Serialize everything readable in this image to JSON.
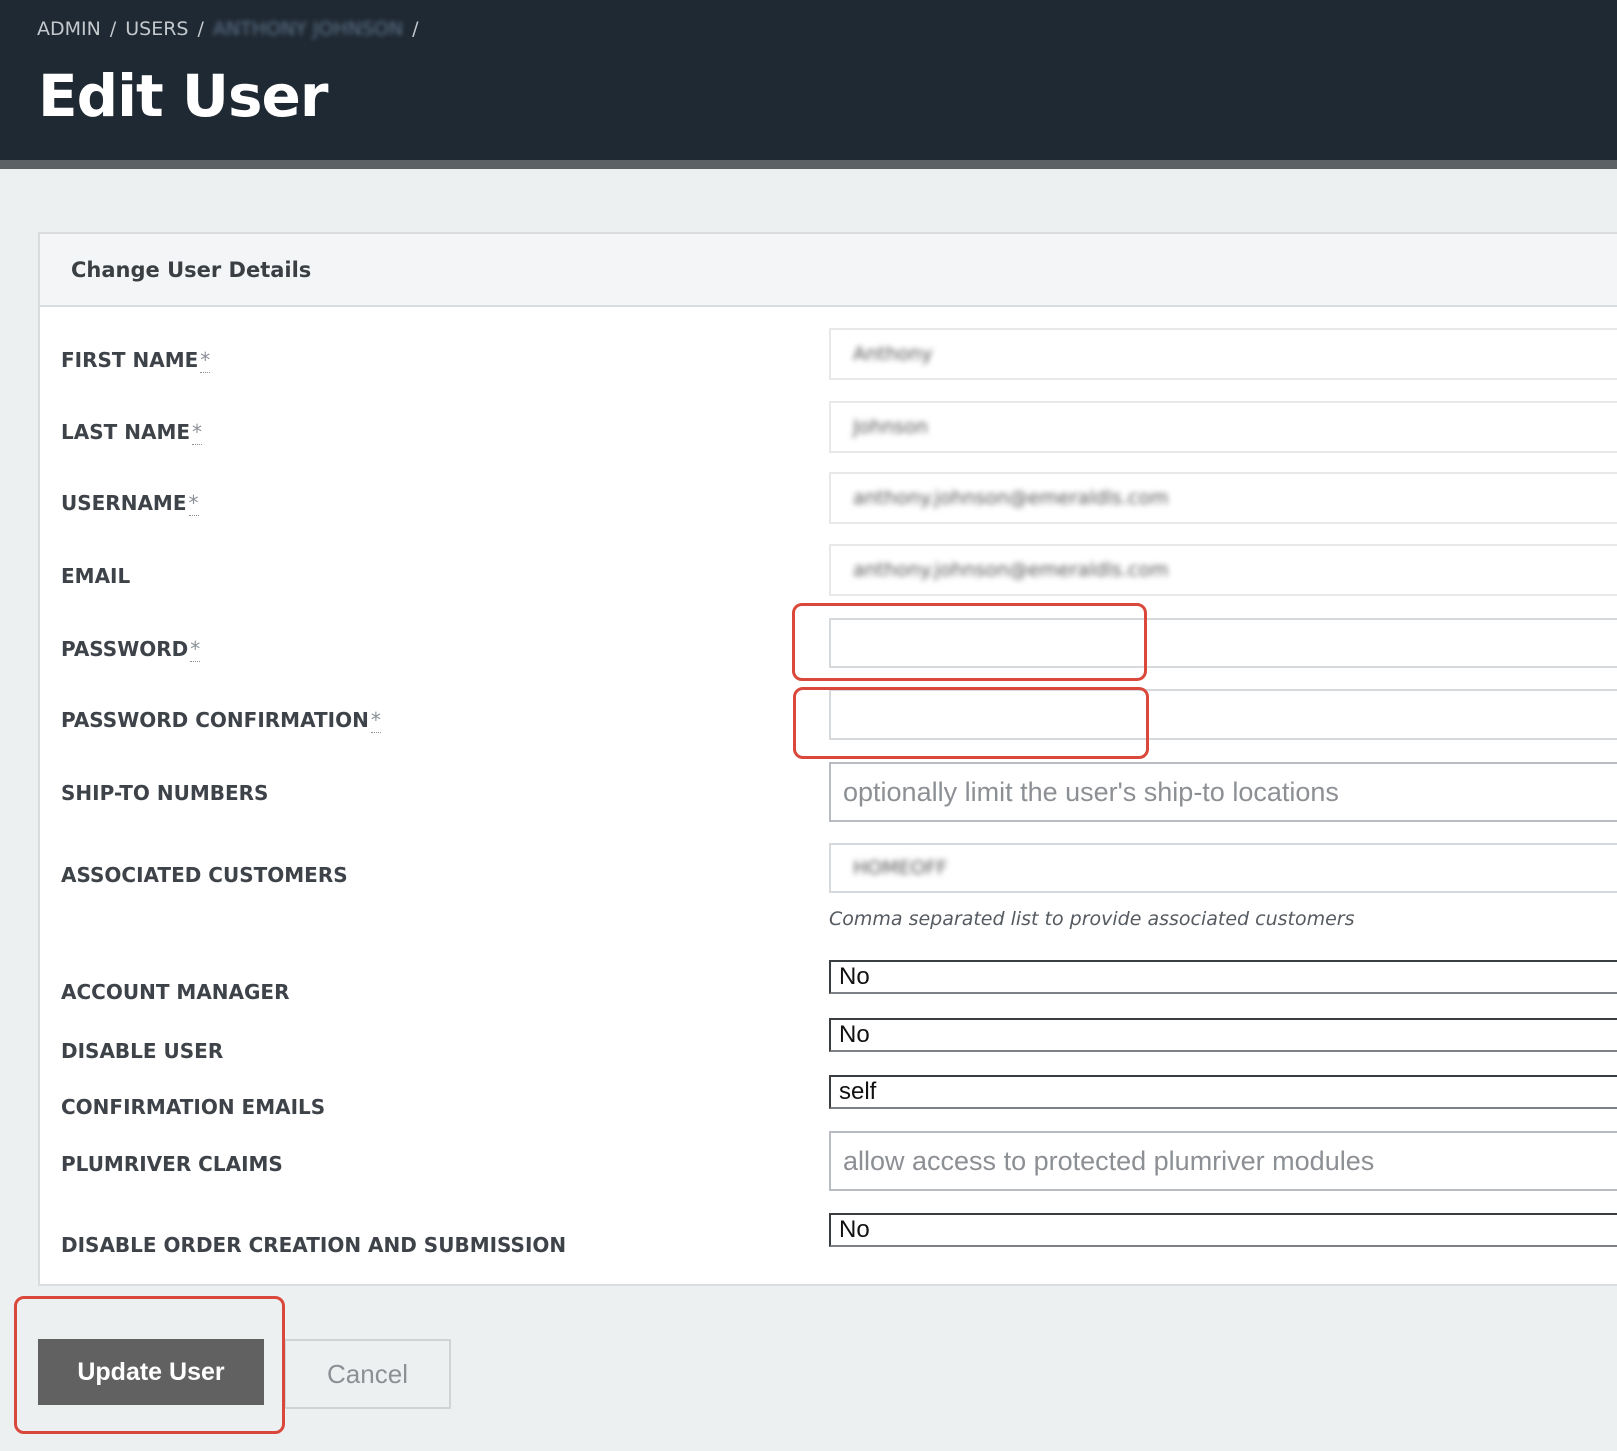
{
  "breadcrumb": {
    "items": [
      "ADMIN",
      "USERS",
      "ANTHONY JOHNSON"
    ],
    "separator": "/"
  },
  "page": {
    "title": "Edit User"
  },
  "panel": {
    "title": "Change User Details"
  },
  "form": {
    "required_mark": "*",
    "first_name": {
      "label": "FIRST NAME",
      "value": "Anthony"
    },
    "last_name": {
      "label": "LAST NAME",
      "value": "Johnson"
    },
    "username": {
      "label": "USERNAME",
      "value": "anthony.johnson@emeraldls.com"
    },
    "email": {
      "label": "EMAIL",
      "value": "anthony.johnson@emeraldls.com"
    },
    "password": {
      "label": "PASSWORD",
      "value": ""
    },
    "password_confirmation": {
      "label": "PASSWORD CONFIRMATION",
      "value": ""
    },
    "ship_to_numbers": {
      "label": "SHIP-TO NUMBERS",
      "placeholder": "optionally limit the user's ship-to locations"
    },
    "associated_customers": {
      "label": "ASSOCIATED CUSTOMERS",
      "value": "HOMEOFF",
      "hint": "Comma separated list to provide associated customers"
    },
    "account_manager": {
      "label": "ACCOUNT MANAGER",
      "value": "No"
    },
    "disable_user": {
      "label": "DISABLE USER",
      "value": "No"
    },
    "confirmation_emails": {
      "label": "CONFIRMATION EMAILS",
      "value": "self"
    },
    "plumriver_claims": {
      "label": "PLUMRIVER CLAIMS",
      "placeholder": "allow access to protected plumriver modules"
    },
    "disable_order_creation": {
      "label": "DISABLE ORDER CREATION AND SUBMISSION",
      "value": "No"
    }
  },
  "actions": {
    "update_label": "Update User",
    "cancel_label": "Cancel"
  },
  "colors": {
    "header_bg": "#1f2933",
    "highlight": "#d9483b",
    "update_button": "#616161"
  }
}
